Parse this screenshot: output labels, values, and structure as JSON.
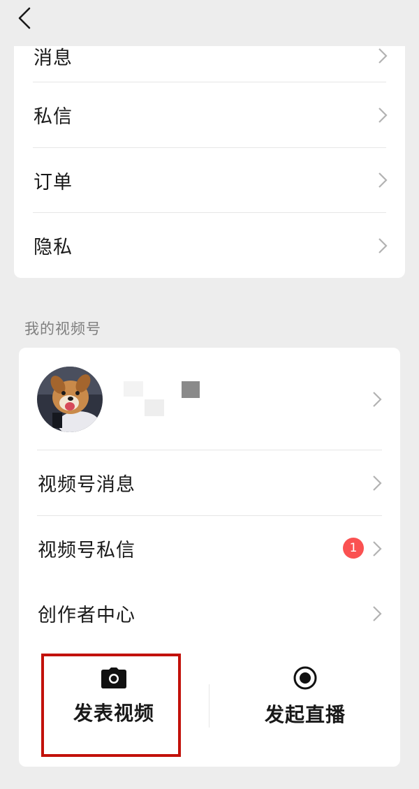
{
  "nav": {
    "back_icon": "chevron-left-icon"
  },
  "settings_list": {
    "items": [
      {
        "label": "消息"
      },
      {
        "label": "私信"
      },
      {
        "label": "订单"
      },
      {
        "label": "隐私"
      }
    ]
  },
  "channels": {
    "section_title": "我的视频号",
    "profile": {
      "avatar": "dog-avatar-image"
    },
    "items": [
      {
        "label": "视频号消息"
      },
      {
        "label": "视频号私信",
        "badge": "1"
      },
      {
        "label": "创作者中心"
      }
    ],
    "actions": {
      "post_video": {
        "label": "发表视频",
        "icon": "camera-icon"
      },
      "start_live": {
        "label": "发起直播",
        "icon": "live-record-icon"
      }
    }
  },
  "colors": {
    "background": "#ededed",
    "card": "#ffffff",
    "badge": "#fa5151",
    "highlight": "#c2110a",
    "chevron": "#b2b2b2"
  }
}
